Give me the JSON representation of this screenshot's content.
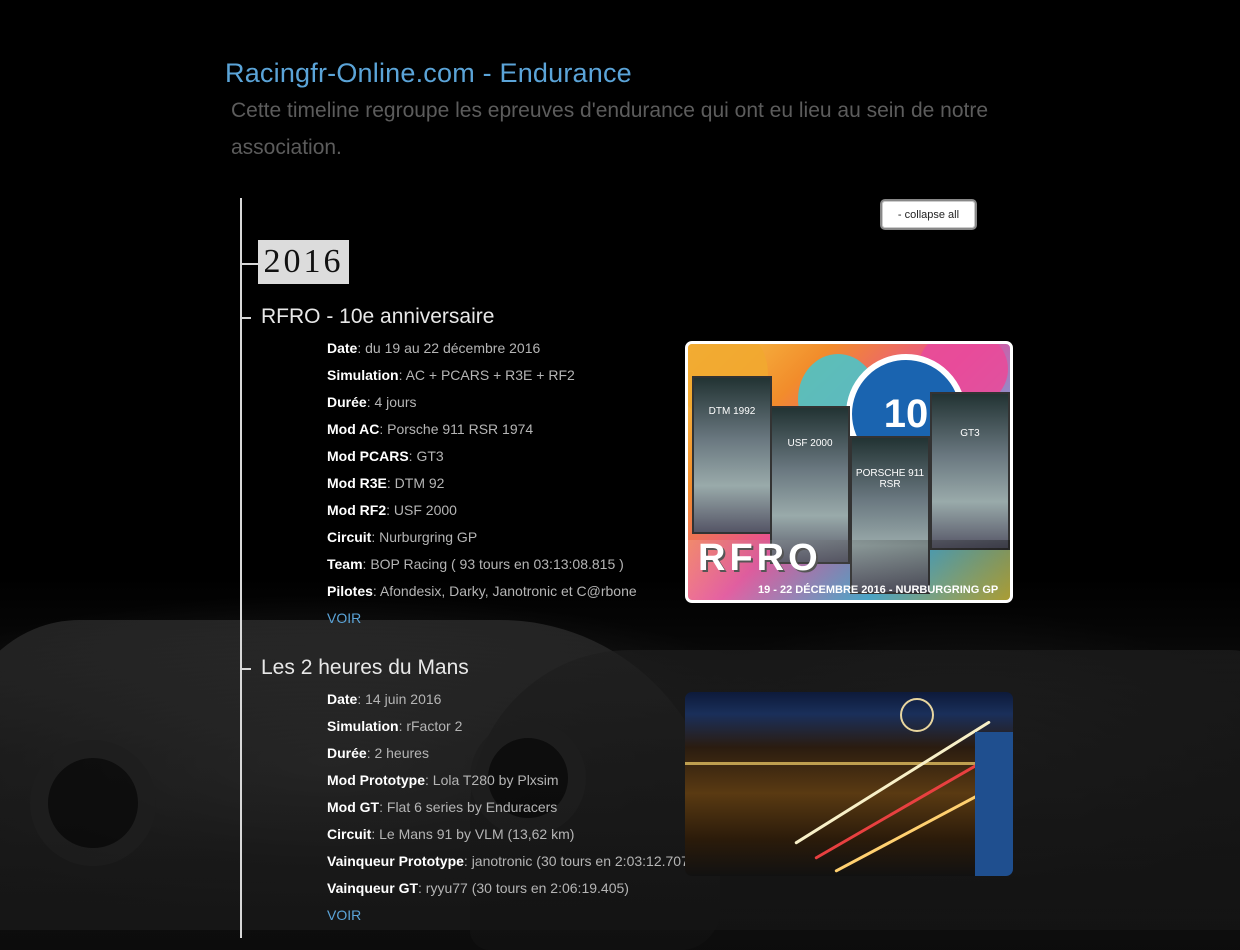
{
  "header": {
    "title": "Racingfr-Online.com - Endurance",
    "intro": "Cette timeline regroupe les epreuves d'endurance qui ont eu lieu au sein de notre association."
  },
  "controls": {
    "collapse_label": "- collapse all"
  },
  "timeline": {
    "year": "2016",
    "events": [
      {
        "title": "RFRO - 10e anniversaire",
        "details": [
          {
            "label": "Date",
            "value": ": du 19 au 22 décembre 2016"
          },
          {
            "label": "Simulation",
            "value": ": AC + PCARS + R3E + RF2"
          },
          {
            "label": "Durée",
            "value": ": 4 jours"
          },
          {
            "label": "Mod AC",
            "value": ": Porsche 911 RSR 1974"
          },
          {
            "label": "Mod PCARS",
            "value": ": GT3"
          },
          {
            "label": "Mod R3E",
            "value": ": DTM 92"
          },
          {
            "label": "Mod RF2",
            "value": ": USF 2000"
          },
          {
            "label": "Circuit",
            "value": ": Nurburgring GP"
          },
          {
            "label": "Team",
            "value": ": BOP Racing ( 93 tours en 03:13:08.815 )"
          },
          {
            "label": "Pilotes",
            "value": ": Afondesix, Darky, Janotronic et C@rbone"
          }
        ],
        "link": "VOIR",
        "image": {
          "ring_text": "10",
          "cards": [
            "DTM 1992",
            "USF 2000",
            "PORSCHE 911 RSR",
            "GT3"
          ],
          "banner_text": "RFRO",
          "caption": "19 - 22 DÉCEMBRE 2016 - NURBURGRING GP"
        }
      },
      {
        "title": "Les 2 heures du Mans",
        "details": [
          {
            "label": "Date",
            "value": ": 14 juin 2016"
          },
          {
            "label": "Simulation",
            "value": ": rFactor 2"
          },
          {
            "label": "Durée",
            "value": ": 2 heures"
          },
          {
            "label": "Mod Prototype",
            "value": ": Lola T280 by Plxsim"
          },
          {
            "label": "Mod GT",
            "value": ": Flat 6 series by Enduracers"
          },
          {
            "label": "Circuit",
            "value": ": Le Mans 91 by VLM (13,62 km)"
          },
          {
            "label": "Vainqueur Prototype",
            "value": ": janotronic (30 tours en 2:03:12.707)"
          },
          {
            "label": "Vainqueur GT",
            "value": ": ryyu77 (30 tours en 2:06:19.405)"
          }
        ],
        "link": "VOIR"
      }
    ]
  },
  "colors": {
    "accent": "#5ba4d8",
    "background": "#000000",
    "line": "#d8d8d8"
  }
}
